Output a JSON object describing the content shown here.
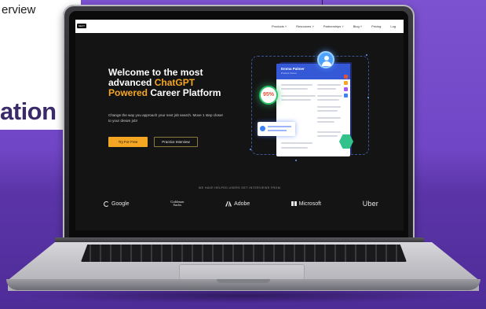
{
  "background": {
    "slide_text_top": "erview",
    "slide_text_big": "ation"
  },
  "nav": {
    "logo_text": "NEXT",
    "items": [
      {
        "label": "Products ˅"
      },
      {
        "label": "Resources ˅"
      },
      {
        "label": "Partnerships ˅"
      },
      {
        "label": "Blog ˅"
      },
      {
        "label": "Pricing"
      },
      {
        "label": "Log"
      }
    ]
  },
  "hero": {
    "title_part1": "Welcome to the most advanced ",
    "title_accent": "ChatGPT Powered",
    "title_part2": " Career Platform",
    "subtitle": "Change the way you approach your next job search. Move 1 step closer to your dream job!",
    "primary_button": "Try For Free",
    "secondary_button": "Practice Interview"
  },
  "illustration": {
    "resume_name": "Emma Palmer",
    "resume_role": "Product Owner",
    "score": "95%",
    "colors": {
      "accent": "#f5a623",
      "resume_header": "#3558d6",
      "score_ring": "#2ec26a",
      "hex": "#32c28a"
    }
  },
  "logos": {
    "caption": "WE HAVE HELPED USERS GET INTERVIEWS FROM",
    "items": [
      {
        "name": "Google"
      },
      {
        "name": "Goldman Sachs",
        "line1": "Goldman",
        "line2": "Sachs"
      },
      {
        "name": "Adobe"
      },
      {
        "name": "Microsoft"
      },
      {
        "name": "Uber"
      }
    ]
  }
}
